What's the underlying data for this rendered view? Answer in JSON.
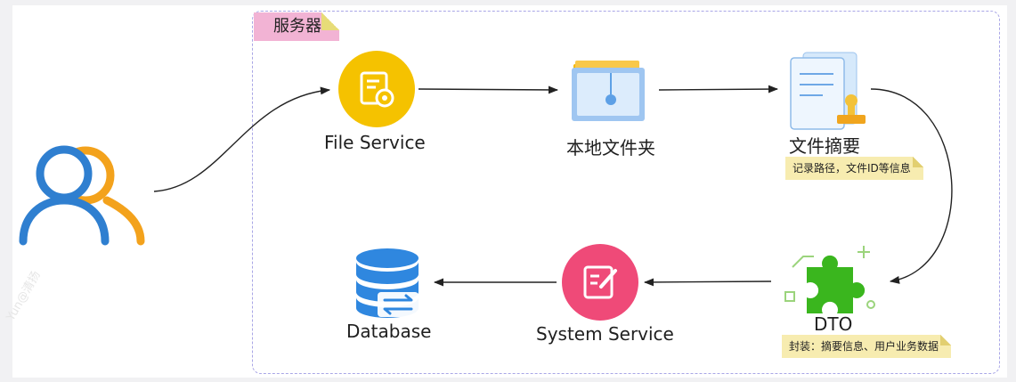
{
  "group": {
    "label": "服务器"
  },
  "nodes": {
    "file_service": "File Service",
    "local_folder": "本地文件夹",
    "file_summary": "文件摘要",
    "dto": "DTO",
    "system_service": "System Service",
    "database": "Database"
  },
  "notes": {
    "summary_note": "记录路径，文件ID等信息",
    "dto_note": "封装：摘要信息、用户业务数据"
  },
  "watermark": "Yun@清扬",
  "colors": {
    "file_service": "#f5c200",
    "system_service": "#ef4a78",
    "user_blue": "#2f7fd0",
    "user_orange": "#f3a21c",
    "database": "#2f87df",
    "dto_green": "#3ab61e"
  }
}
